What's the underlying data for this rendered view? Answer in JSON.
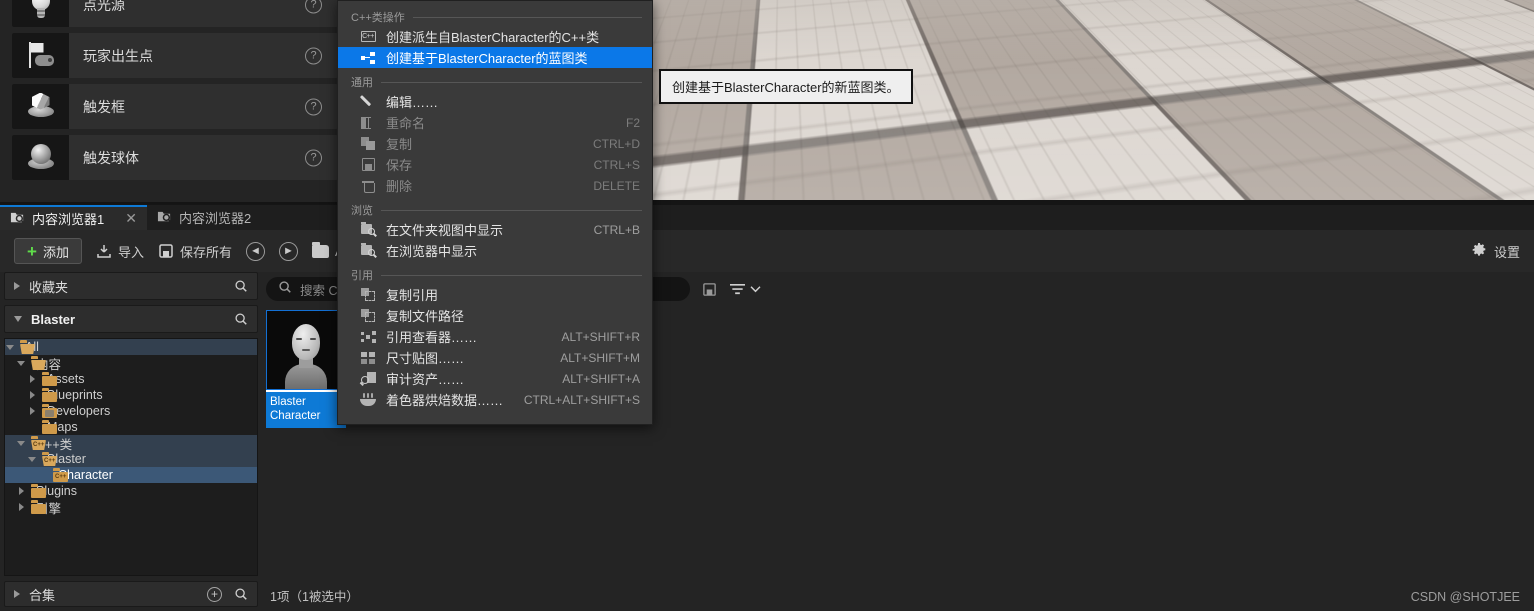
{
  "viewport": {
    "name": "level-viewport"
  },
  "place_panel": {
    "items": [
      {
        "label": "点光源",
        "icon": "point-light-icon",
        "help": "?"
      },
      {
        "label": "玩家出生点",
        "icon": "player-start-icon",
        "help": "?"
      },
      {
        "label": "触发框",
        "icon": "trigger-box-icon",
        "help": "?"
      },
      {
        "label": "触发球体",
        "icon": "trigger-sphere-icon",
        "help": "?"
      }
    ]
  },
  "content_browser": {
    "tabs": [
      {
        "label": "内容浏览器1",
        "active": true,
        "close": "✕"
      },
      {
        "label": "内容浏览器2",
        "active": false,
        "close": ""
      }
    ],
    "toolbar": {
      "add_label": "添加",
      "add_plus": "+",
      "import_label": "导入",
      "save_all_label": "保存所有",
      "back_glyph": "◄",
      "forward_glyph": "►",
      "path_label": "A",
      "settings_label": "设置"
    },
    "favorites": {
      "label": "收藏夹"
    },
    "source_header": {
      "label": "Blaster"
    },
    "tree": [
      {
        "label": "All",
        "depth": 0,
        "expander": "down",
        "icon": "folder-open-icon",
        "state": "soft-selected"
      },
      {
        "label": "内容",
        "depth": 1,
        "expander": "down",
        "icon": "folder-open-icon",
        "state": "normal"
      },
      {
        "label": "Assets",
        "depth": 2,
        "expander": "right",
        "icon": "folder-icon",
        "state": "normal"
      },
      {
        "label": "Blueprints",
        "depth": 2,
        "expander": "right",
        "icon": "folder-icon",
        "state": "normal"
      },
      {
        "label": "Developers",
        "depth": 2,
        "expander": "right",
        "icon": "folder-developers-icon",
        "state": "normal"
      },
      {
        "label": "Maps",
        "depth": 2,
        "expander": "none",
        "icon": "folder-icon",
        "state": "normal"
      },
      {
        "label": "C++类",
        "depth": 1,
        "expander": "down",
        "icon": "folder-cpp-icon",
        "state": "soft-selected"
      },
      {
        "label": "Blaster",
        "depth": 2,
        "expander": "down",
        "icon": "folder-cpp-icon",
        "state": "soft-selected"
      },
      {
        "label": "Character",
        "depth": 3,
        "expander": "none",
        "icon": "folder-cpp-icon",
        "state": "selected"
      },
      {
        "label": "Plugins",
        "depth": 1,
        "expander": "right",
        "icon": "folder-icon",
        "state": "normal"
      },
      {
        "label": "引擎",
        "depth": 1,
        "expander": "right",
        "icon": "folder-icon",
        "state": "normal"
      }
    ],
    "collections": {
      "label": "合集",
      "add_glyph": "+"
    },
    "search": {
      "placeholder": "搜索 Ch"
    },
    "assets": [
      {
        "name": "Blaster\nCharacter",
        "selected": true,
        "icon": "character-thumbnail"
      }
    ],
    "status": "1项（1被选中）",
    "watermark": "CSDN @SHOTJEE"
  },
  "context_menu": {
    "sections": [
      {
        "title": "C++类操作",
        "items": [
          {
            "label": "创建派生自BlasterCharacter的C++类",
            "shortcut": "",
            "icon": "cpp-class-icon",
            "state": "enabled"
          },
          {
            "label": "创建基于BlasterCharacter的蓝图类",
            "shortcut": "",
            "icon": "blueprint-class-icon",
            "state": "highlighted"
          }
        ]
      },
      {
        "title": "通用",
        "items": [
          {
            "label": "编辑……",
            "shortcut": "",
            "icon": "pencil-icon",
            "state": "enabled"
          },
          {
            "label": "重命名",
            "shortcut": "F2",
            "icon": "rename-icon",
            "state": "disabled"
          },
          {
            "label": "复制",
            "shortcut": "CTRL+D",
            "icon": "duplicate-icon",
            "state": "disabled"
          },
          {
            "label": "保存",
            "shortcut": "CTRL+S",
            "icon": "save-icon",
            "state": "disabled"
          },
          {
            "label": "删除",
            "shortcut": "DELETE",
            "icon": "trash-icon",
            "state": "disabled"
          }
        ]
      },
      {
        "title": "浏览",
        "items": [
          {
            "label": "在文件夹视图中显示",
            "shortcut": "CTRL+B",
            "icon": "show-in-folder-icon",
            "state": "enabled"
          },
          {
            "label": "在浏览器中显示",
            "shortcut": "",
            "icon": "show-in-explorer-icon",
            "state": "enabled"
          }
        ]
      },
      {
        "title": "引用",
        "items": [
          {
            "label": "复制引用",
            "shortcut": "",
            "icon": "copy-reference-icon",
            "state": "enabled"
          },
          {
            "label": "复制文件路径",
            "shortcut": "",
            "icon": "copy-file-path-icon",
            "state": "enabled"
          },
          {
            "label": "引用查看器……",
            "shortcut": "ALT+SHIFT+R",
            "icon": "reference-viewer-icon",
            "state": "enabled"
          },
          {
            "label": "尺寸贴图……",
            "shortcut": "ALT+SHIFT+M",
            "icon": "size-map-icon",
            "state": "enabled"
          },
          {
            "label": "审计资产……",
            "shortcut": "ALT+SHIFT+A",
            "icon": "audit-assets-icon",
            "state": "enabled"
          },
          {
            "label": "着色器烘焙数据……",
            "shortcut": "CTRL+ALT+SHIFT+S",
            "icon": "shader-cook-icon",
            "state": "enabled"
          }
        ]
      }
    ]
  },
  "tooltip": {
    "text": "创建基于BlasterCharacter的新蓝图类。"
  },
  "colors": {
    "accent_blue": "#0b78e8",
    "selection_blue": "#0e7ad6",
    "folder_gold": "#cf9a4a",
    "menu_bg": "#3a3a3a",
    "panel_bg": "#242424"
  }
}
